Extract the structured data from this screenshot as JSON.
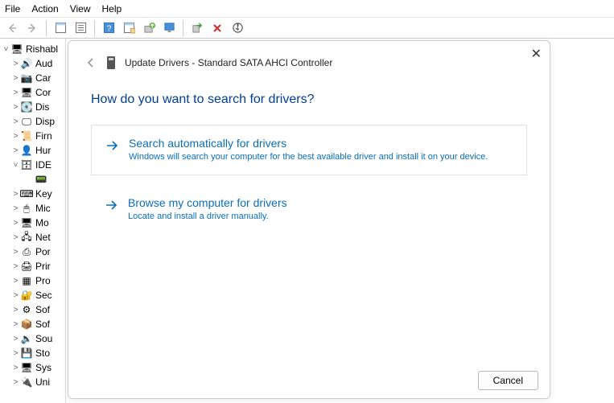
{
  "menubar": {
    "file": "File",
    "action": "Action",
    "view": "View",
    "help": "Help"
  },
  "toolbar": {
    "back": "←",
    "forward": "→",
    "up": "↥",
    "show": "▥",
    "help": "?",
    "props": "▤",
    "refresh": "⟳",
    "monitor": "🖵",
    "enable": "➕",
    "remove": "✖",
    "update": "⬇"
  },
  "tree": {
    "root": "Rishabl",
    "items": [
      {
        "exp": ">",
        "ico": "🔊",
        "label": "Aud"
      },
      {
        "exp": ">",
        "ico": "📷",
        "label": "Car"
      },
      {
        "exp": ">",
        "ico": "🖥",
        "label": "Cor"
      },
      {
        "exp": ">",
        "ico": "💽",
        "label": "Dis"
      },
      {
        "exp": ">",
        "ico": "🖵",
        "label": "Disp"
      },
      {
        "exp": ">",
        "ico": "📜",
        "label": "Firn"
      },
      {
        "exp": ">",
        "ico": "👤",
        "label": "Hur"
      },
      {
        "exp": "˅",
        "ico": "🗄",
        "label": "IDE"
      },
      {
        "exp": "",
        "ico": "📟",
        "label": "",
        "indent": true
      },
      {
        "exp": ">",
        "ico": "⌨",
        "label": "Key"
      },
      {
        "exp": ">",
        "ico": "🖱",
        "label": "Mic"
      },
      {
        "exp": ">",
        "ico": "🖥",
        "label": "Mo"
      },
      {
        "exp": ">",
        "ico": "🖧",
        "label": "Net"
      },
      {
        "exp": ">",
        "ico": "⎙",
        "label": "Por"
      },
      {
        "exp": ">",
        "ico": "🖨",
        "label": "Prir"
      },
      {
        "exp": ">",
        "ico": "▦",
        "label": "Pro"
      },
      {
        "exp": ">",
        "ico": "🔐",
        "label": "Sec"
      },
      {
        "exp": ">",
        "ico": "⚙",
        "label": "Sof"
      },
      {
        "exp": ">",
        "ico": "📦",
        "label": "Sof"
      },
      {
        "exp": ">",
        "ico": "🔉",
        "label": "Sou"
      },
      {
        "exp": ">",
        "ico": "💾",
        "label": "Sto"
      },
      {
        "exp": ">",
        "ico": "🖥",
        "label": "Sys"
      },
      {
        "exp": ">",
        "ico": "🔌",
        "label": "Uni"
      }
    ]
  },
  "dialog": {
    "title": "Update Drivers - Standard SATA AHCI Controller",
    "question": "How do you want to search for drivers?",
    "opt1_title": "Search automatically for drivers",
    "opt1_desc": "Windows will search your computer for the best available driver and install it on your device.",
    "opt2_title": "Browse my computer for drivers",
    "opt2_desc": "Locate and install a driver manually.",
    "cancel": "Cancel"
  }
}
